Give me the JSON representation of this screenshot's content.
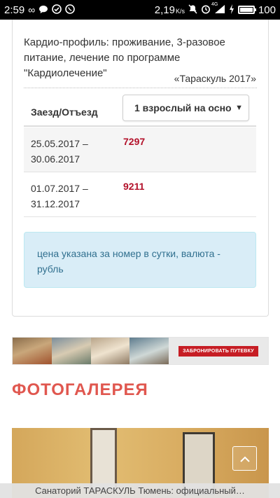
{
  "status_bar": {
    "time": "2:59",
    "speed": "2,19",
    "speed_unit": "K/s",
    "network": "4G",
    "battery": "100",
    "left_icons": [
      "infinity-icon",
      "chat-bubble-icon",
      "check-circle-icon",
      "viber-icon"
    ],
    "right_icons": [
      "mute-icon",
      "alarm-icon",
      "signal-icon",
      "charging-icon",
      "battery-icon"
    ]
  },
  "program": {
    "description": "Кардио-профиль: проживание, 3-разовое питание, лечение по программе \"Кардиолечение\"",
    "year_tag": "«Тараскуль 2017»"
  },
  "price_table": {
    "column_header": "Заезд/Отъезд",
    "occupancy_select": {
      "selected": "1 взрослый на осно",
      "caret": "▼"
    },
    "rows": [
      {
        "dates": "25.05.2017 – 30.06.2017",
        "price": "7297"
      },
      {
        "dates": "01.07.2017 – 31.12.2017",
        "price": "9211"
      }
    ]
  },
  "note": "цена указана за номер в сутки, валюта - рубль",
  "banner": {
    "cta": "ЗАБРОНИРОВАТЬ ПУТЕВКУ"
  },
  "gallery": {
    "title": "ФОТОГАЛЕРЕЯ"
  },
  "scroll_top_icon": "chevron-up-icon",
  "url_bar": "Санаторий ТАРАСКУЛЬ Тюмень: официальный…",
  "colors": {
    "price": "#b3112a",
    "gallery_title": "#e0574f",
    "note_bg": "#d9edf7",
    "note_text": "#31708f",
    "banner_button": "#c61d24"
  }
}
